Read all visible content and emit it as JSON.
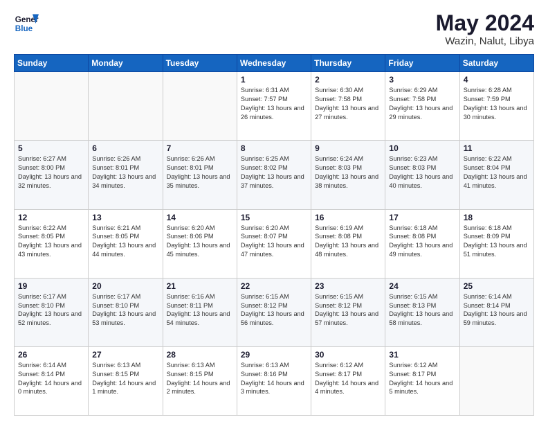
{
  "header": {
    "title": "May 2024",
    "location": "Wazin, Nalut, Libya"
  },
  "weekdays": [
    "Sunday",
    "Monday",
    "Tuesday",
    "Wednesday",
    "Thursday",
    "Friday",
    "Saturday"
  ],
  "weeks": [
    [
      {
        "day": "",
        "info": ""
      },
      {
        "day": "",
        "info": ""
      },
      {
        "day": "",
        "info": ""
      },
      {
        "day": "1",
        "info": "Sunrise: 6:31 AM\nSunset: 7:57 PM\nDaylight: 13 hours\nand 26 minutes."
      },
      {
        "day": "2",
        "info": "Sunrise: 6:30 AM\nSunset: 7:58 PM\nDaylight: 13 hours\nand 27 minutes."
      },
      {
        "day": "3",
        "info": "Sunrise: 6:29 AM\nSunset: 7:58 PM\nDaylight: 13 hours\nand 29 minutes."
      },
      {
        "day": "4",
        "info": "Sunrise: 6:28 AM\nSunset: 7:59 PM\nDaylight: 13 hours\nand 30 minutes."
      }
    ],
    [
      {
        "day": "5",
        "info": "Sunrise: 6:27 AM\nSunset: 8:00 PM\nDaylight: 13 hours\nand 32 minutes."
      },
      {
        "day": "6",
        "info": "Sunrise: 6:26 AM\nSunset: 8:01 PM\nDaylight: 13 hours\nand 34 minutes."
      },
      {
        "day": "7",
        "info": "Sunrise: 6:26 AM\nSunset: 8:01 PM\nDaylight: 13 hours\nand 35 minutes."
      },
      {
        "day": "8",
        "info": "Sunrise: 6:25 AM\nSunset: 8:02 PM\nDaylight: 13 hours\nand 37 minutes."
      },
      {
        "day": "9",
        "info": "Sunrise: 6:24 AM\nSunset: 8:03 PM\nDaylight: 13 hours\nand 38 minutes."
      },
      {
        "day": "10",
        "info": "Sunrise: 6:23 AM\nSunset: 8:03 PM\nDaylight: 13 hours\nand 40 minutes."
      },
      {
        "day": "11",
        "info": "Sunrise: 6:22 AM\nSunset: 8:04 PM\nDaylight: 13 hours\nand 41 minutes."
      }
    ],
    [
      {
        "day": "12",
        "info": "Sunrise: 6:22 AM\nSunset: 8:05 PM\nDaylight: 13 hours\nand 43 minutes."
      },
      {
        "day": "13",
        "info": "Sunrise: 6:21 AM\nSunset: 8:05 PM\nDaylight: 13 hours\nand 44 minutes."
      },
      {
        "day": "14",
        "info": "Sunrise: 6:20 AM\nSunset: 8:06 PM\nDaylight: 13 hours\nand 45 minutes."
      },
      {
        "day": "15",
        "info": "Sunrise: 6:20 AM\nSunset: 8:07 PM\nDaylight: 13 hours\nand 47 minutes."
      },
      {
        "day": "16",
        "info": "Sunrise: 6:19 AM\nSunset: 8:08 PM\nDaylight: 13 hours\nand 48 minutes."
      },
      {
        "day": "17",
        "info": "Sunrise: 6:18 AM\nSunset: 8:08 PM\nDaylight: 13 hours\nand 49 minutes."
      },
      {
        "day": "18",
        "info": "Sunrise: 6:18 AM\nSunset: 8:09 PM\nDaylight: 13 hours\nand 51 minutes."
      }
    ],
    [
      {
        "day": "19",
        "info": "Sunrise: 6:17 AM\nSunset: 8:10 PM\nDaylight: 13 hours\nand 52 minutes."
      },
      {
        "day": "20",
        "info": "Sunrise: 6:17 AM\nSunset: 8:10 PM\nDaylight: 13 hours\nand 53 minutes."
      },
      {
        "day": "21",
        "info": "Sunrise: 6:16 AM\nSunset: 8:11 PM\nDaylight: 13 hours\nand 54 minutes."
      },
      {
        "day": "22",
        "info": "Sunrise: 6:15 AM\nSunset: 8:12 PM\nDaylight: 13 hours\nand 56 minutes."
      },
      {
        "day": "23",
        "info": "Sunrise: 6:15 AM\nSunset: 8:12 PM\nDaylight: 13 hours\nand 57 minutes."
      },
      {
        "day": "24",
        "info": "Sunrise: 6:15 AM\nSunset: 8:13 PM\nDaylight: 13 hours\nand 58 minutes."
      },
      {
        "day": "25",
        "info": "Sunrise: 6:14 AM\nSunset: 8:14 PM\nDaylight: 13 hours\nand 59 minutes."
      }
    ],
    [
      {
        "day": "26",
        "info": "Sunrise: 6:14 AM\nSunset: 8:14 PM\nDaylight: 14 hours\nand 0 minutes."
      },
      {
        "day": "27",
        "info": "Sunrise: 6:13 AM\nSunset: 8:15 PM\nDaylight: 14 hours\nand 1 minute."
      },
      {
        "day": "28",
        "info": "Sunrise: 6:13 AM\nSunset: 8:15 PM\nDaylight: 14 hours\nand 2 minutes."
      },
      {
        "day": "29",
        "info": "Sunrise: 6:13 AM\nSunset: 8:16 PM\nDaylight: 14 hours\nand 3 minutes."
      },
      {
        "day": "30",
        "info": "Sunrise: 6:12 AM\nSunset: 8:17 PM\nDaylight: 14 hours\nand 4 minutes."
      },
      {
        "day": "31",
        "info": "Sunrise: 6:12 AM\nSunset: 8:17 PM\nDaylight: 14 hours\nand 5 minutes."
      },
      {
        "day": "",
        "info": ""
      }
    ]
  ]
}
